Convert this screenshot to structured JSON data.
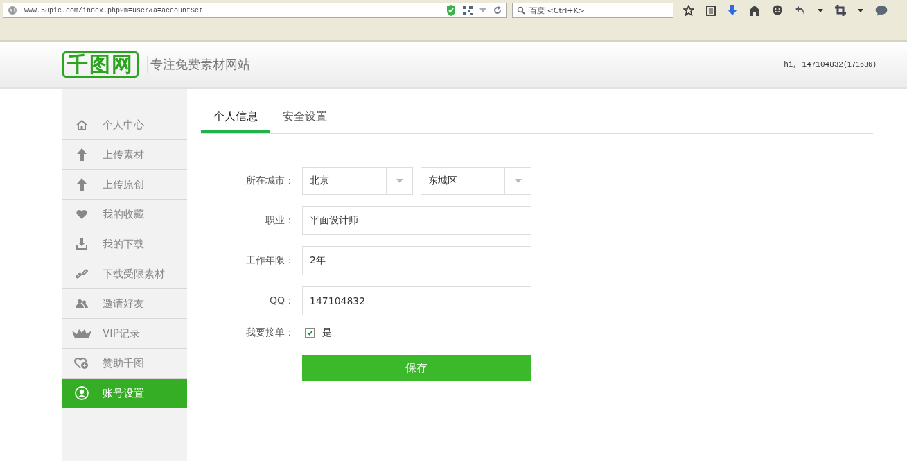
{
  "browser": {
    "url": "www.58pic.com/index.php?m=user&a=accountSet",
    "search_placeholder": "百度 <Ctrl+K>"
  },
  "header": {
    "logo": "千图网",
    "slogan": "专注免费素材网站",
    "greeting": "hi, 147104832",
    "user_id": "(171636)"
  },
  "sidebar": {
    "items": [
      {
        "label": "个人中心",
        "kind": "home",
        "selected": false
      },
      {
        "label": "上传素材",
        "kind": "upload",
        "selected": false
      },
      {
        "label": "上传原创",
        "kind": "upload",
        "selected": false
      },
      {
        "label": "我的收藏",
        "kind": "heart",
        "selected": false
      },
      {
        "label": "我的下载",
        "kind": "download",
        "selected": false
      },
      {
        "label": "下载受限素材",
        "kind": "link",
        "selected": false
      },
      {
        "label": "邀请好友",
        "kind": "users",
        "selected": false
      },
      {
        "label": "VIP记录",
        "kind": "crown",
        "selected": false
      },
      {
        "label": "赞助千图",
        "kind": "heartplus",
        "selected": false
      },
      {
        "label": "账号设置",
        "kind": "user",
        "selected": true
      }
    ]
  },
  "tabs": [
    {
      "label": "个人信息",
      "selected": true
    },
    {
      "label": "安全设置",
      "selected": false
    }
  ],
  "form": {
    "rows": [
      {
        "kind": "selects",
        "label": "所在城市：",
        "values": [
          "北京",
          "东城区"
        ]
      },
      {
        "kind": "text",
        "label": "职业：",
        "value": "平面设计师"
      },
      {
        "kind": "text",
        "label": "工作年限：",
        "value": "2年"
      },
      {
        "kind": "text",
        "label": "QQ：",
        "value": "147104832"
      },
      {
        "kind": "checkbox",
        "label": "我要接单：",
        "option": "是",
        "checked": true
      }
    ],
    "submit": "保存"
  }
}
